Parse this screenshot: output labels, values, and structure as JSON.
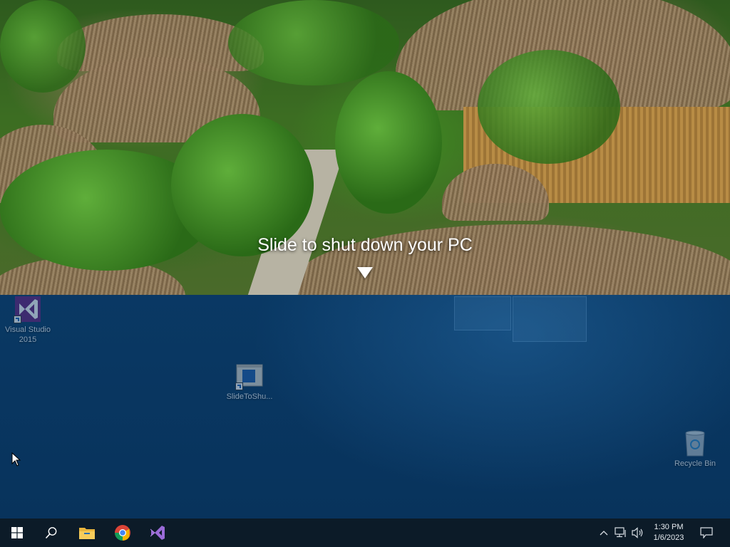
{
  "shutdown": {
    "prompt": "Slide to shut down your PC"
  },
  "desktop": {
    "icons": [
      {
        "name": "visual-studio-2015-shortcut",
        "label": "Visual Studio 2015"
      },
      {
        "name": "slidetoshutdown-shortcut",
        "label": "SlideToShu..."
      },
      {
        "name": "recycle-bin",
        "label": "Recycle Bin"
      }
    ]
  },
  "taskbar": {
    "pinned": [
      {
        "name": "start-button",
        "icon": "windows-logo-icon"
      },
      {
        "name": "search-button",
        "icon": "search-icon"
      },
      {
        "name": "file-explorer-button",
        "icon": "folder-icon"
      },
      {
        "name": "chrome-button",
        "icon": "chrome-icon"
      },
      {
        "name": "visual-studio-button",
        "icon": "visual-studio-icon"
      }
    ],
    "tray": {
      "time": "1:30 PM",
      "date": "1/6/2023"
    }
  },
  "colors": {
    "taskbar": "#0c1b28",
    "desktop": "#0a3a66",
    "vs_purple": "#68217a"
  }
}
